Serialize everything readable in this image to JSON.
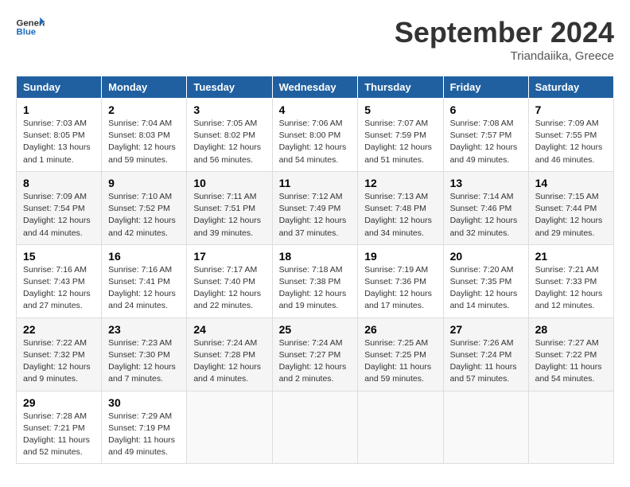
{
  "logo": {
    "text_general": "General",
    "text_blue": "Blue"
  },
  "title": "September 2024",
  "subtitle": "Triandaiika, Greece",
  "days_of_week": [
    "Sunday",
    "Monday",
    "Tuesday",
    "Wednesday",
    "Thursday",
    "Friday",
    "Saturday"
  ],
  "weeks": [
    [
      {
        "day": "1",
        "sunrise": "Sunrise: 7:03 AM",
        "sunset": "Sunset: 8:05 PM",
        "daylight": "Daylight: 13 hours and 1 minute."
      },
      {
        "day": "2",
        "sunrise": "Sunrise: 7:04 AM",
        "sunset": "Sunset: 8:03 PM",
        "daylight": "Daylight: 12 hours and 59 minutes."
      },
      {
        "day": "3",
        "sunrise": "Sunrise: 7:05 AM",
        "sunset": "Sunset: 8:02 PM",
        "daylight": "Daylight: 12 hours and 56 minutes."
      },
      {
        "day": "4",
        "sunrise": "Sunrise: 7:06 AM",
        "sunset": "Sunset: 8:00 PM",
        "daylight": "Daylight: 12 hours and 54 minutes."
      },
      {
        "day": "5",
        "sunrise": "Sunrise: 7:07 AM",
        "sunset": "Sunset: 7:59 PM",
        "daylight": "Daylight: 12 hours and 51 minutes."
      },
      {
        "day": "6",
        "sunrise": "Sunrise: 7:08 AM",
        "sunset": "Sunset: 7:57 PM",
        "daylight": "Daylight: 12 hours and 49 minutes."
      },
      {
        "day": "7",
        "sunrise": "Sunrise: 7:09 AM",
        "sunset": "Sunset: 7:55 PM",
        "daylight": "Daylight: 12 hours and 46 minutes."
      }
    ],
    [
      {
        "day": "8",
        "sunrise": "Sunrise: 7:09 AM",
        "sunset": "Sunset: 7:54 PM",
        "daylight": "Daylight: 12 hours and 44 minutes."
      },
      {
        "day": "9",
        "sunrise": "Sunrise: 7:10 AM",
        "sunset": "Sunset: 7:52 PM",
        "daylight": "Daylight: 12 hours and 42 minutes."
      },
      {
        "day": "10",
        "sunrise": "Sunrise: 7:11 AM",
        "sunset": "Sunset: 7:51 PM",
        "daylight": "Daylight: 12 hours and 39 minutes."
      },
      {
        "day": "11",
        "sunrise": "Sunrise: 7:12 AM",
        "sunset": "Sunset: 7:49 PM",
        "daylight": "Daylight: 12 hours and 37 minutes."
      },
      {
        "day": "12",
        "sunrise": "Sunrise: 7:13 AM",
        "sunset": "Sunset: 7:48 PM",
        "daylight": "Daylight: 12 hours and 34 minutes."
      },
      {
        "day": "13",
        "sunrise": "Sunrise: 7:14 AM",
        "sunset": "Sunset: 7:46 PM",
        "daylight": "Daylight: 12 hours and 32 minutes."
      },
      {
        "day": "14",
        "sunrise": "Sunrise: 7:15 AM",
        "sunset": "Sunset: 7:44 PM",
        "daylight": "Daylight: 12 hours and 29 minutes."
      }
    ],
    [
      {
        "day": "15",
        "sunrise": "Sunrise: 7:16 AM",
        "sunset": "Sunset: 7:43 PM",
        "daylight": "Daylight: 12 hours and 27 minutes."
      },
      {
        "day": "16",
        "sunrise": "Sunrise: 7:16 AM",
        "sunset": "Sunset: 7:41 PM",
        "daylight": "Daylight: 12 hours and 24 minutes."
      },
      {
        "day": "17",
        "sunrise": "Sunrise: 7:17 AM",
        "sunset": "Sunset: 7:40 PM",
        "daylight": "Daylight: 12 hours and 22 minutes."
      },
      {
        "day": "18",
        "sunrise": "Sunrise: 7:18 AM",
        "sunset": "Sunset: 7:38 PM",
        "daylight": "Daylight: 12 hours and 19 minutes."
      },
      {
        "day": "19",
        "sunrise": "Sunrise: 7:19 AM",
        "sunset": "Sunset: 7:36 PM",
        "daylight": "Daylight: 12 hours and 17 minutes."
      },
      {
        "day": "20",
        "sunrise": "Sunrise: 7:20 AM",
        "sunset": "Sunset: 7:35 PM",
        "daylight": "Daylight: 12 hours and 14 minutes."
      },
      {
        "day": "21",
        "sunrise": "Sunrise: 7:21 AM",
        "sunset": "Sunset: 7:33 PM",
        "daylight": "Daylight: 12 hours and 12 minutes."
      }
    ],
    [
      {
        "day": "22",
        "sunrise": "Sunrise: 7:22 AM",
        "sunset": "Sunset: 7:32 PM",
        "daylight": "Daylight: 12 hours and 9 minutes."
      },
      {
        "day": "23",
        "sunrise": "Sunrise: 7:23 AM",
        "sunset": "Sunset: 7:30 PM",
        "daylight": "Daylight: 12 hours and 7 minutes."
      },
      {
        "day": "24",
        "sunrise": "Sunrise: 7:24 AM",
        "sunset": "Sunset: 7:28 PM",
        "daylight": "Daylight: 12 hours and 4 minutes."
      },
      {
        "day": "25",
        "sunrise": "Sunrise: 7:24 AM",
        "sunset": "Sunset: 7:27 PM",
        "daylight": "Daylight: 12 hours and 2 minutes."
      },
      {
        "day": "26",
        "sunrise": "Sunrise: 7:25 AM",
        "sunset": "Sunset: 7:25 PM",
        "daylight": "Daylight: 11 hours and 59 minutes."
      },
      {
        "day": "27",
        "sunrise": "Sunrise: 7:26 AM",
        "sunset": "Sunset: 7:24 PM",
        "daylight": "Daylight: 11 hours and 57 minutes."
      },
      {
        "day": "28",
        "sunrise": "Sunrise: 7:27 AM",
        "sunset": "Sunset: 7:22 PM",
        "daylight": "Daylight: 11 hours and 54 minutes."
      }
    ],
    [
      {
        "day": "29",
        "sunrise": "Sunrise: 7:28 AM",
        "sunset": "Sunset: 7:21 PM",
        "daylight": "Daylight: 11 hours and 52 minutes."
      },
      {
        "day": "30",
        "sunrise": "Sunrise: 7:29 AM",
        "sunset": "Sunset: 7:19 PM",
        "daylight": "Daylight: 11 hours and 49 minutes."
      },
      null,
      null,
      null,
      null,
      null
    ]
  ]
}
